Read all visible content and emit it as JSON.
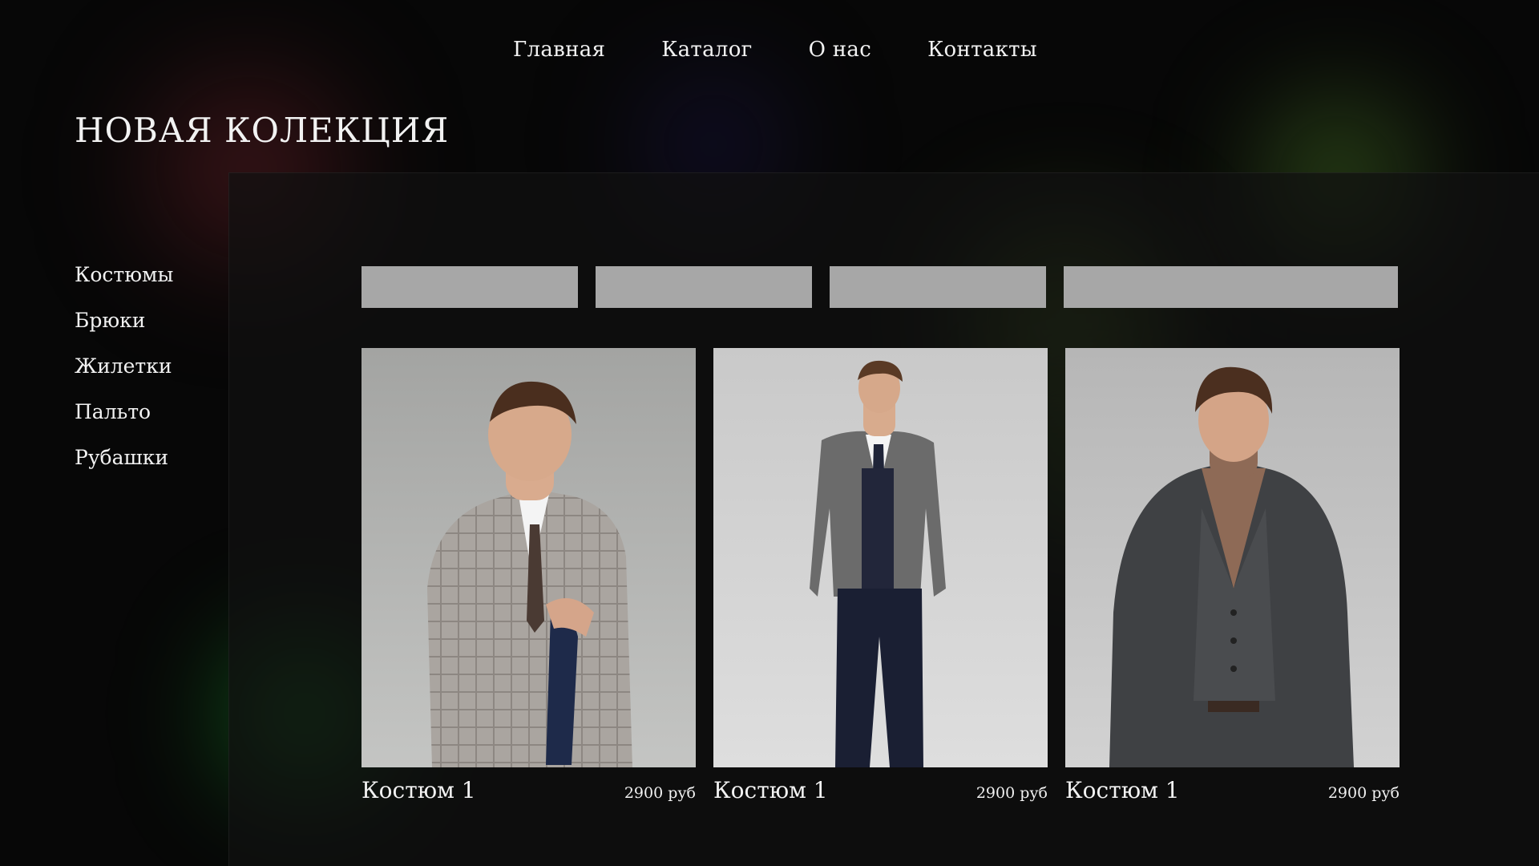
{
  "nav": {
    "items": [
      {
        "label": "Главная"
      },
      {
        "label": "Каталог"
      },
      {
        "label": "О нас"
      },
      {
        "label": "Контакты"
      }
    ]
  },
  "page_title": "НОВАЯ КОЛЕКЦИЯ",
  "sidebar": {
    "items": [
      {
        "label": "Костюмы"
      },
      {
        "label": "Брюки"
      },
      {
        "label": "Жилетки"
      },
      {
        "label": "Пальто"
      },
      {
        "label": "Рубашки"
      }
    ]
  },
  "filters": {
    "count": 4,
    "color": "#a7a7a7"
  },
  "products": [
    {
      "name": "Костюм 1",
      "price": "2900 руб",
      "image": "man-in-light-grey-check-suit"
    },
    {
      "name": "Костюм 1",
      "price": "2900 руб",
      "image": "man-in-grey-jacket-navy-trousers"
    },
    {
      "name": "Костюм 1",
      "price": "2900 руб",
      "image": "man-in-dark-three-piece-suit-turtleneck"
    }
  ],
  "colors": {
    "background": "#070707",
    "text": "#f2f2f2",
    "accent_glow": "#2ad24a"
  }
}
